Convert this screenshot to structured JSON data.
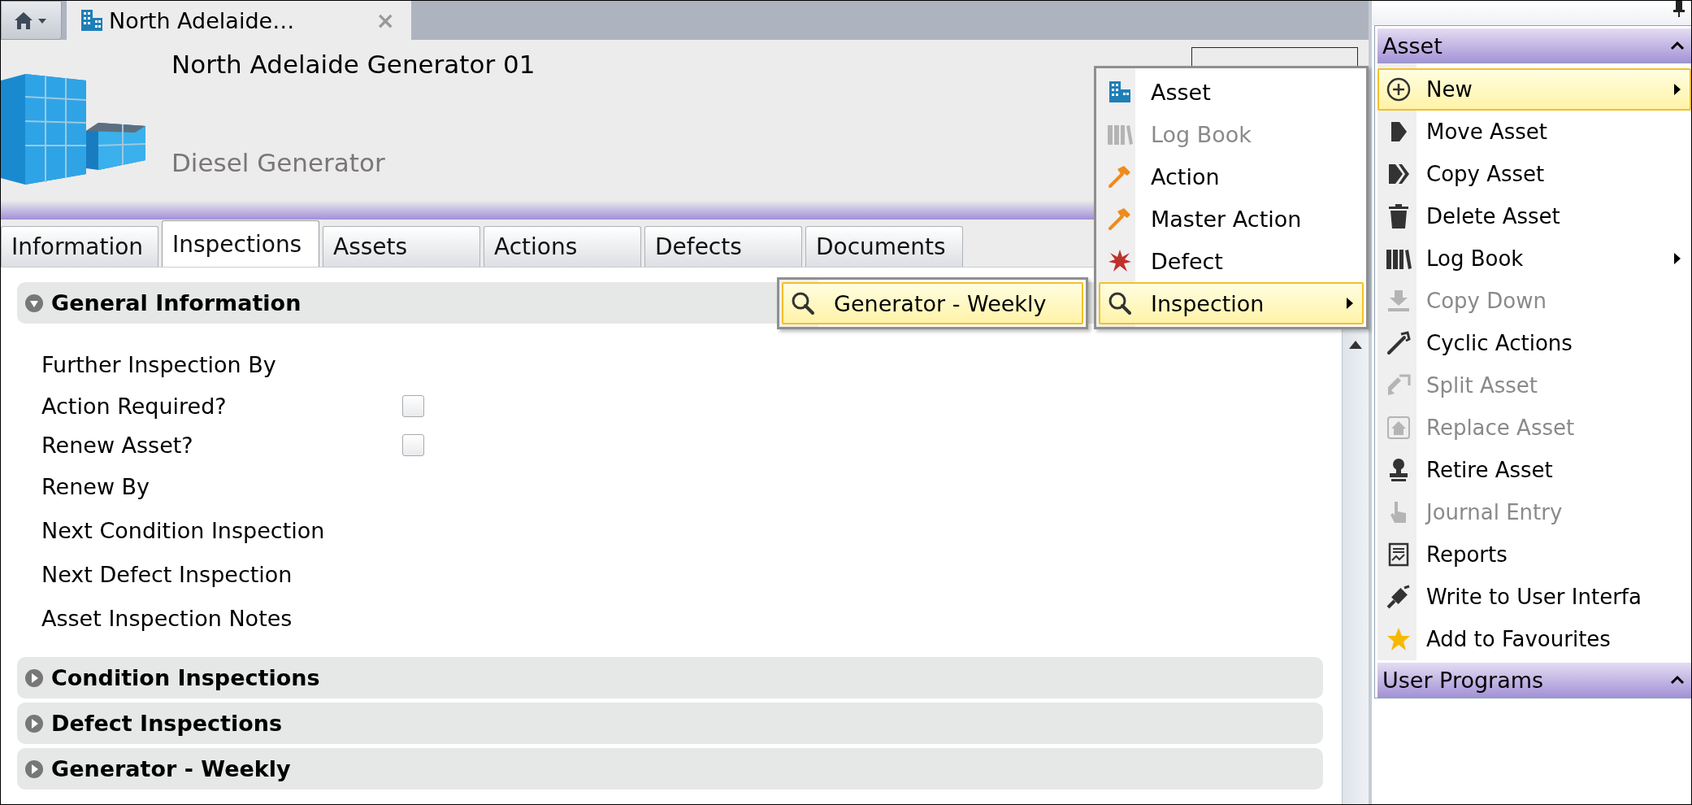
{
  "document_tab": {
    "title": "North Adelaide…",
    "close": "×"
  },
  "header": {
    "title": "North Adelaide Generator 01",
    "subtitle": "Diesel Generator"
  },
  "tabs": [
    {
      "label": "Information",
      "selected": false
    },
    {
      "label": "Inspections",
      "selected": true
    },
    {
      "label": "Assets",
      "selected": false
    },
    {
      "label": "Actions",
      "selected": false
    },
    {
      "label": "Defects",
      "selected": false
    },
    {
      "label": "Documents",
      "selected": false
    }
  ],
  "sections": [
    {
      "title": "General Information",
      "expanded": true,
      "fields": [
        {
          "label": "Further Inspection By",
          "kind": "text"
        },
        {
          "label": "Action Required?",
          "kind": "checkbox",
          "checked": false
        },
        {
          "label": "Renew Asset?",
          "kind": "checkbox",
          "checked": false
        },
        {
          "label": "Renew By",
          "kind": "text"
        },
        {
          "label": "Next Condition Inspection",
          "kind": "text"
        },
        {
          "label": "Next Defect Inspection",
          "kind": "text"
        },
        {
          "label": "Asset Inspection Notes",
          "kind": "text"
        }
      ]
    },
    {
      "title": "Condition Inspections",
      "expanded": false
    },
    {
      "title": "Defect Inspections",
      "expanded": false
    },
    {
      "title": "Generator - Weekly",
      "expanded": false
    }
  ],
  "new_menu": {
    "items": [
      {
        "label": "Asset",
        "disabled": false,
        "highlighted": false,
        "submenu": false
      },
      {
        "label": "Log Book",
        "disabled": true,
        "highlighted": false,
        "submenu": false
      },
      {
        "label": "Action",
        "disabled": false,
        "highlighted": false,
        "submenu": false
      },
      {
        "label": "Master Action",
        "disabled": false,
        "highlighted": false,
        "submenu": false
      },
      {
        "label": "Defect",
        "disabled": false,
        "highlighted": false,
        "submenu": false
      },
      {
        "label": "Inspection",
        "disabled": false,
        "highlighted": true,
        "submenu": true
      }
    ]
  },
  "inspection_menu": {
    "items": [
      {
        "label": "Generator - Weekly",
        "disabled": false,
        "highlighted": true,
        "submenu": false
      }
    ]
  },
  "action_panel": {
    "sections": [
      {
        "title": "Asset",
        "expanded": true,
        "items": [
          {
            "label": "New",
            "disabled": false,
            "highlighted": true,
            "submenu": true
          },
          {
            "label": "Move Asset",
            "disabled": false,
            "highlighted": false,
            "submenu": false
          },
          {
            "label": "Copy Asset",
            "disabled": false,
            "highlighted": false,
            "submenu": false
          },
          {
            "label": "Delete Asset",
            "disabled": false,
            "highlighted": false,
            "submenu": false
          },
          {
            "label": "Log Book",
            "disabled": false,
            "highlighted": false,
            "submenu": true
          },
          {
            "label": "Copy Down",
            "disabled": true,
            "highlighted": false,
            "submenu": false
          },
          {
            "label": "Cyclic Actions",
            "disabled": false,
            "highlighted": false,
            "submenu": false
          },
          {
            "label": "Split Asset",
            "disabled": true,
            "highlighted": false,
            "submenu": false
          },
          {
            "label": "Replace Asset",
            "disabled": true,
            "highlighted": false,
            "submenu": false
          },
          {
            "label": "Retire Asset",
            "disabled": false,
            "highlighted": false,
            "submenu": false
          },
          {
            "label": "Journal Entry",
            "disabled": true,
            "highlighted": false,
            "submenu": false
          },
          {
            "label": "Reports",
            "disabled": false,
            "highlighted": false,
            "submenu": false
          },
          {
            "label": "Write to User Interfa",
            "disabled": false,
            "highlighted": false,
            "submenu": false
          },
          {
            "label": "Add to Favourites",
            "disabled": false,
            "highlighted": false,
            "submenu": false
          }
        ]
      },
      {
        "title": "User Programs",
        "expanded": true
      }
    ]
  }
}
